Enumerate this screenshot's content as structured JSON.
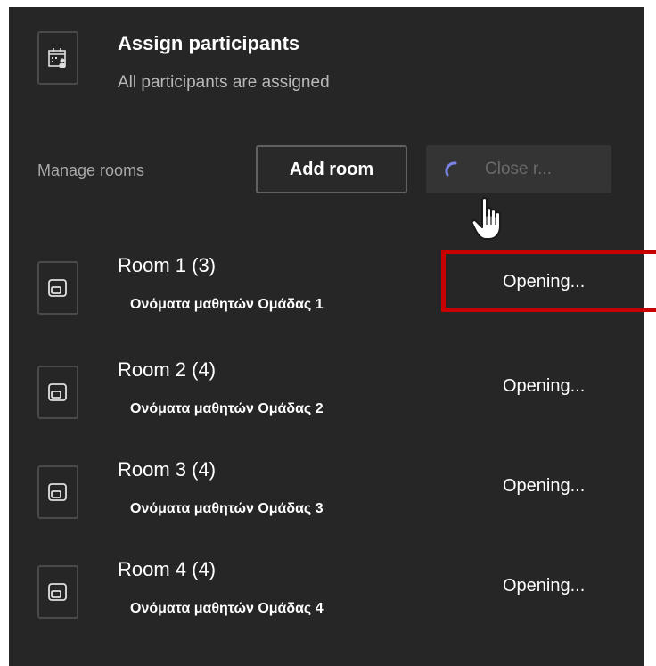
{
  "assign": {
    "title": "Assign participants",
    "subtitle": "All participants are assigned",
    "icon": "calendar-people-icon"
  },
  "manage": {
    "label": "Manage rooms",
    "add_room_label": "Add room",
    "close_rooms_label": "Close r..."
  },
  "rooms": [
    {
      "name": "Room 1 (3)",
      "members": "Ονόματα μαθητών Ομάδας 1",
      "status": "Opening..."
    },
    {
      "name": "Room 2 (4)",
      "members": "Ονόματα μαθητών Ομάδας 2",
      "status": "Opening..."
    },
    {
      "name": "Room 3 (4)",
      "members": "Ονόματα μαθητών Ομάδας 3",
      "status": "Opening..."
    },
    {
      "name": "Room 4 (4)",
      "members": "Ονόματα μαθητών Ομάδας 4",
      "status": "Opening..."
    }
  ],
  "colors": {
    "panel_bg": "#262626",
    "highlight": "#c80000",
    "spinner": "#7b83eb"
  }
}
